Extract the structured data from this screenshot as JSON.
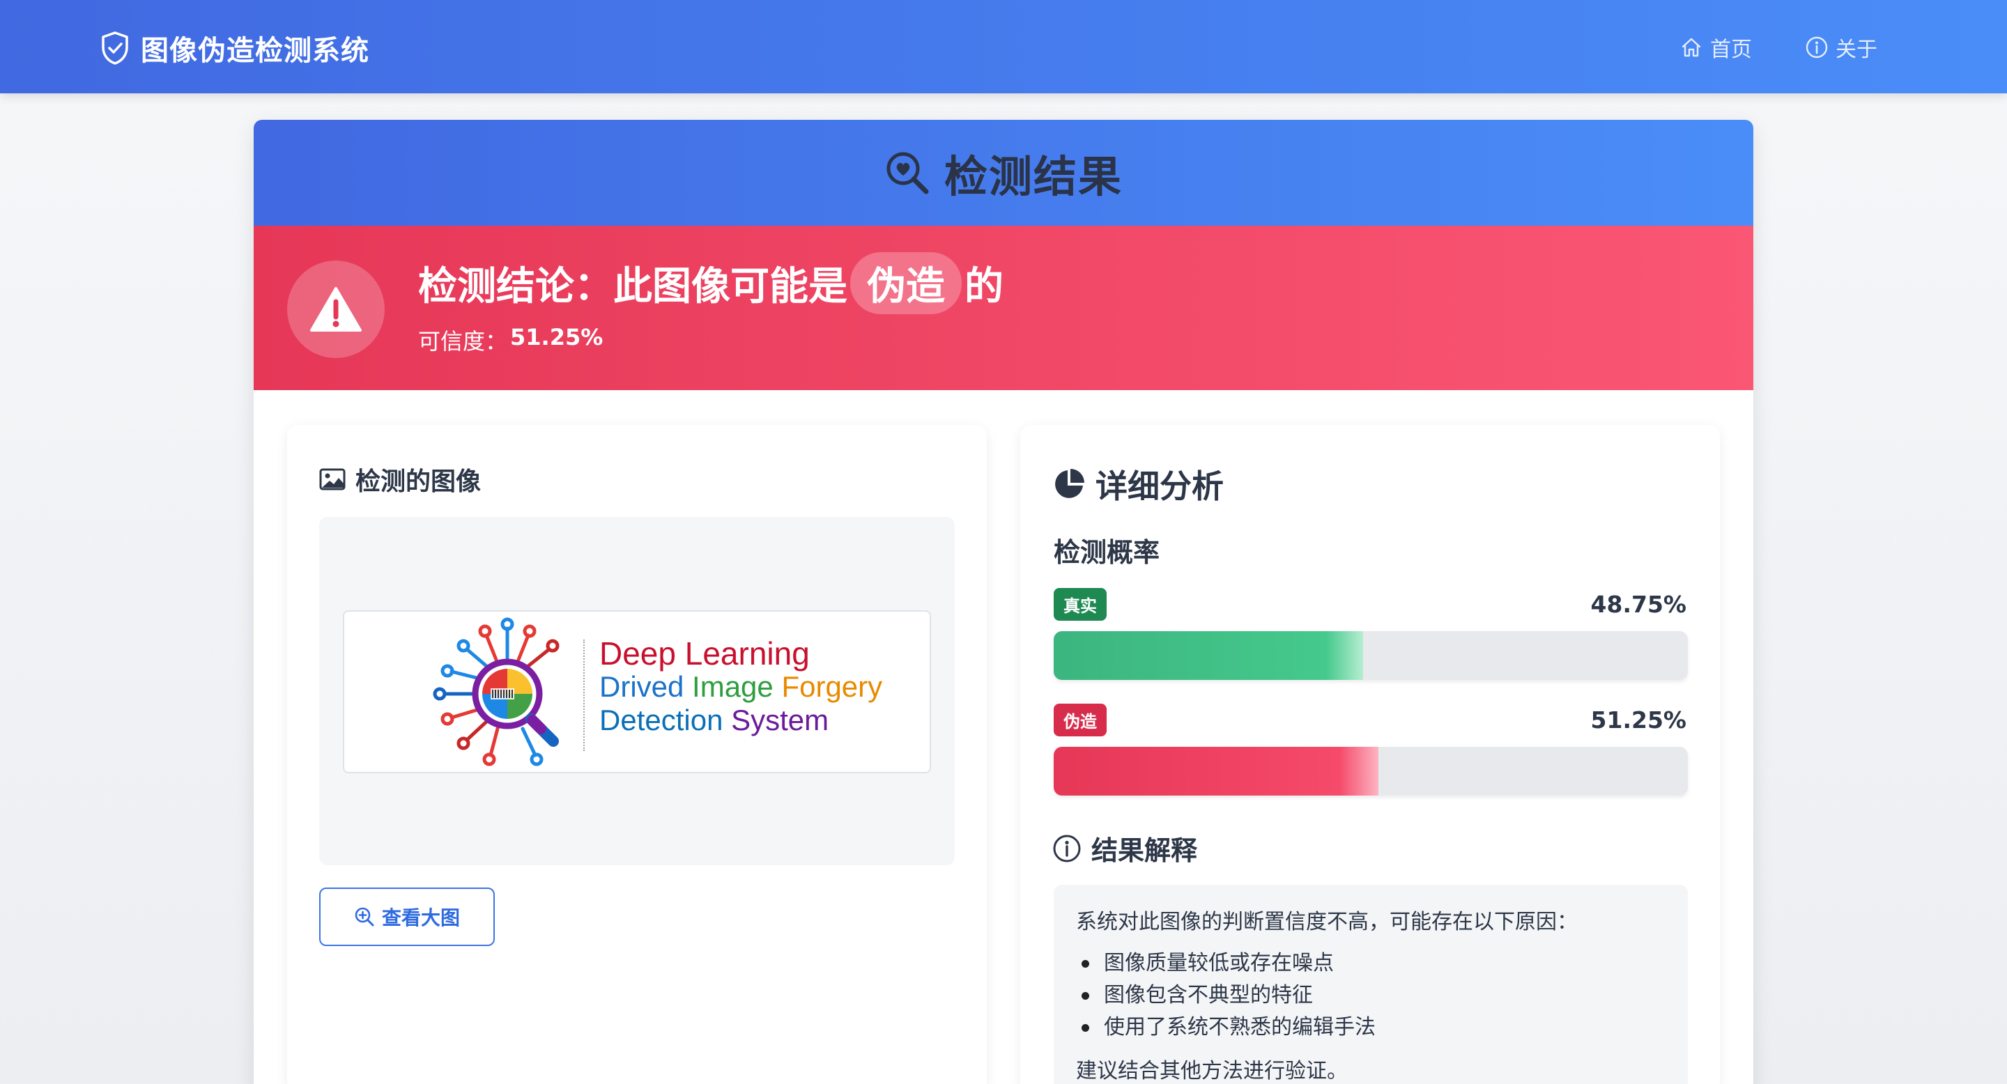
{
  "app": {
    "title": "图像伪造检测系统"
  },
  "nav": {
    "items": [
      {
        "label": "首页",
        "icon": "home-icon"
      },
      {
        "label": "关于",
        "icon": "info-icon"
      }
    ]
  },
  "result": {
    "title": "检测结果",
    "verdict": {
      "prefix": "检测结论：此图像可能是",
      "label": "伪造",
      "suffix": "的",
      "confidence_label": "可信度：",
      "confidence_value": "51.25%",
      "confidence": 0.5125,
      "color": "#e63757"
    }
  },
  "image_panel": {
    "title": "检测的图像",
    "logo_text": {
      "line1": "Deep Learning",
      "line2_a": "Drived",
      "line2_b": "Image",
      "line2_c": "Forgery",
      "line3_a": "Detection",
      "line3_b": "System"
    },
    "zoom_button": "查看大图"
  },
  "analysis": {
    "title": "详细分析",
    "probability_title": "检测概率",
    "bars": [
      {
        "label": "真实",
        "value_text": "48.75%",
        "value": 0.4875,
        "color": "#3cb57f"
      },
      {
        "label": "伪造",
        "value_text": "51.25%",
        "value": 0.5125,
        "color": "#e63757"
      }
    ],
    "explanation": {
      "title": "结果解释",
      "intro": "系统对此图像的判断置信度不高，可能存在以下原因：",
      "reasons": [
        "图像质量较低或存在噪点",
        "图像包含不典型的特征",
        "使用了系统不熟悉的编辑手法"
      ],
      "suggestion": "建议结合其他方法进行验证。"
    }
  },
  "colors": {
    "primary": "#4169e1",
    "danger": "#e63757",
    "success": "#1e8a52"
  }
}
